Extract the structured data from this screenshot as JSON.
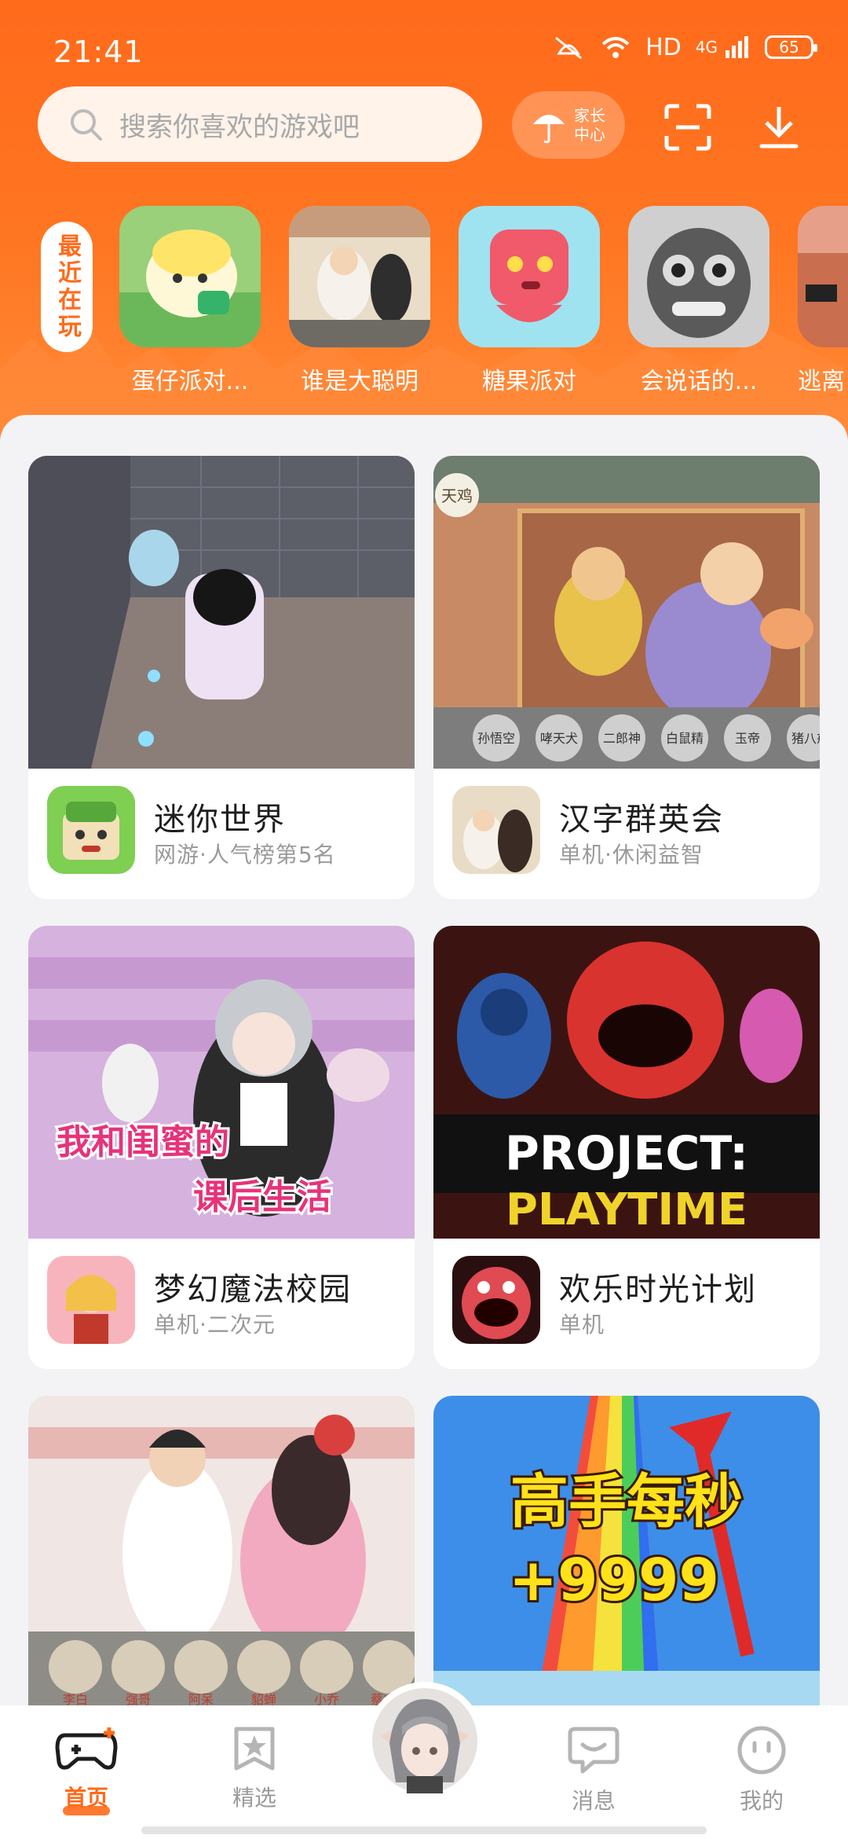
{
  "status": {
    "time": "21:41",
    "network": "HD",
    "signal": "4G",
    "battery": "65"
  },
  "search": {
    "placeholder": "搜索你喜欢的游戏吧"
  },
  "parent_center": {
    "label": "家长中心"
  },
  "recent": {
    "label": "最近在玩",
    "items": [
      {
        "name": "蛋仔派对..."
      },
      {
        "name": "谁是大聪明"
      },
      {
        "name": "糖果派对"
      },
      {
        "name": "会说话的..."
      },
      {
        "name": "逃离"
      }
    ]
  },
  "cards": [
    {
      "title": "迷你世界",
      "subtitle": "网游·人气榜第5名"
    },
    {
      "title": "汉字群英会",
      "subtitle": "单机·休闲益智",
      "banner_tag": "天鸡",
      "names": [
        "孙悟空",
        "哮天犬",
        "二郎神",
        "白鼠精",
        "玉帝",
        "猪八戒"
      ]
    },
    {
      "title": "梦幻魔法校园",
      "subtitle": "单机·二次元",
      "banner_text": [
        "我和闺蜜的",
        "课后生活"
      ]
    },
    {
      "title": "欢乐时光计划",
      "subtitle": "单机",
      "banner_text": [
        "PROJECT:",
        "PLAYTIME"
      ]
    },
    {
      "title": "",
      "subtitle": "",
      "names": [
        "李白",
        "强哥",
        "阿呆",
        "貂蝉",
        "小乔",
        "蔡文姬"
      ]
    },
    {
      "title": "",
      "subtitle": "",
      "banner_text": [
        "高手每秒",
        "+9999"
      ]
    }
  ],
  "nav": {
    "home": "首页",
    "featured": "精选",
    "messages": "消息",
    "mine": "我的"
  },
  "colors": {
    "accent": "#ff6a1b"
  }
}
